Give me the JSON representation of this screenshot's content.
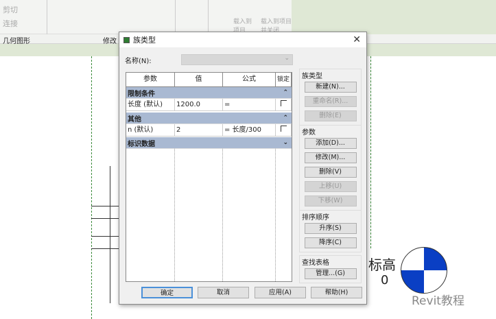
{
  "ribbon": {
    "cut": "剪切",
    "join": "连接",
    "load_to_project": "载入到项目",
    "load_close": "载入到项目并关闭"
  },
  "panels": {
    "geometry": "几何图形",
    "modify": "修改"
  },
  "dialog": {
    "title": "族类型",
    "close": "✕",
    "name_label": "名称(N):",
    "table": {
      "headers": [
        "参数",
        "值",
        "公式",
        "锁定"
      ],
      "groups": [
        {
          "label": "限制条件",
          "chevron": "⌃",
          "rows": [
            {
              "param": "长度 (默认)",
              "value": "1200.0",
              "formula": "="
            }
          ]
        },
        {
          "label": "其他",
          "chevron": "⌃",
          "rows": [
            {
              "param": "n (默认)",
              "value": "2",
              "formula": "= 长度/300"
            }
          ]
        },
        {
          "label": "标识数据",
          "chevron": "⌄",
          "rows": []
        }
      ]
    },
    "family_types": {
      "label": "族类型",
      "new": "新建(N)...",
      "rename": "重命名(R)...",
      "delete": "删除(E)"
    },
    "parameters": {
      "label": "参数",
      "add": "添加(D)...",
      "modify": "修改(M)...",
      "delete": "删除(V)",
      "up": "上移(U)",
      "down": "下移(W)"
    },
    "sort": {
      "label": "排序顺序",
      "asc": "升序(S)",
      "desc": "降序(C)"
    },
    "lookup": {
      "label": "查找表格",
      "manage": "管理...(G)"
    },
    "footer": {
      "ok": "确定",
      "cancel": "取消",
      "apply": "应用(A)",
      "help": "帮助(H)"
    }
  },
  "canvas": {
    "level_label": "标高",
    "level_value": "0"
  },
  "watermark": "Revit教程",
  "colors": {
    "group_header": "#a9b9d2",
    "level_symbol": "#0a3fc4"
  }
}
